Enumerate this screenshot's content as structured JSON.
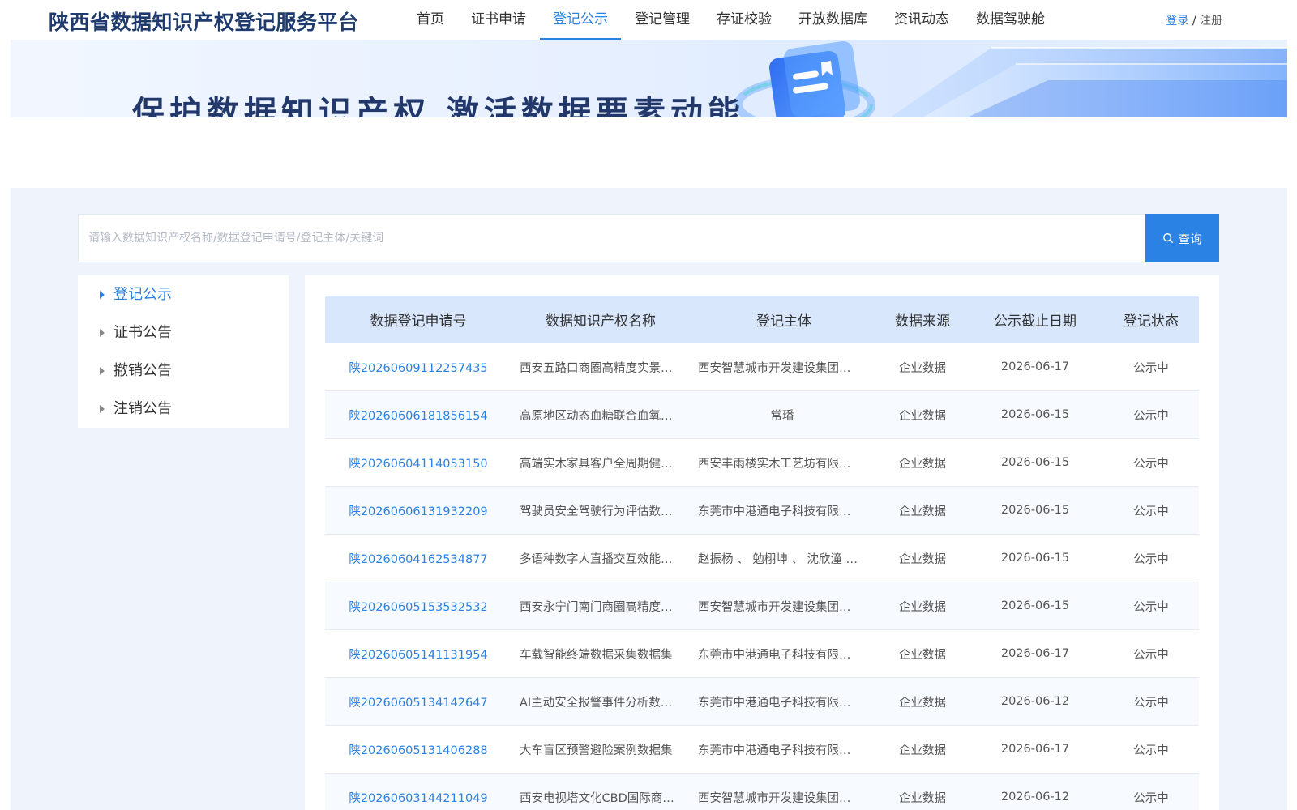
{
  "header": {
    "title": "陕西省数据知识产权登记服务平台",
    "nav": [
      "首页",
      "证书申请",
      "登记公示",
      "登记管理",
      "存证校验",
      "开放数据库",
      "资讯动态",
      "数据驾驶舱"
    ],
    "active_nav": 2,
    "login": "登录",
    "separator": " / ",
    "register": "注册"
  },
  "banner": {
    "slogan": "保护数据知识产权 激活数据要素动能"
  },
  "search": {
    "placeholder": "请输入数据知识产权名称/数据登记申请号/登记主体/关键词",
    "button_label": "查询"
  },
  "sidebar": {
    "items": [
      "登记公示",
      "证书公告",
      "撤销公告",
      "注销公告"
    ],
    "active": 0
  },
  "table": {
    "headers": [
      "数据登记申请号",
      "数据知识产权名称",
      "登记主体",
      "数据来源",
      "公示截止日期",
      "登记状态"
    ],
    "rows": [
      [
        "陕20260609112257435",
        "西安五路口商圈高精度实景…",
        "西安智慧城市开发建设集团…",
        "企业数据",
        "2026-06-17",
        "公示中"
      ],
      [
        "陕20260606181856154",
        "高原地区动态血糖联合血氧…",
        "常璠",
        "企业数据",
        "2026-06-15",
        "公示中"
      ],
      [
        "陕20260604114053150",
        "高端实木家具客户全周期健…",
        "西安丰雨楼实木工艺坊有限…",
        "企业数据",
        "2026-06-15",
        "公示中"
      ],
      [
        "陕20260606131932209",
        "驾驶员安全驾驶行为评估数…",
        "东莞市中港通电子科技有限…",
        "企业数据",
        "2026-06-15",
        "公示中"
      ],
      [
        "陕20260604162534877",
        "多语种数字人直播交互效能…",
        "赵振杨 、 勉栩坤 、 沈欣潼 …",
        "企业数据",
        "2026-06-15",
        "公示中"
      ],
      [
        "陕20260605153532532",
        "西安永宁门南门商圈高精度…",
        "西安智慧城市开发建设集团…",
        "企业数据",
        "2026-06-15",
        "公示中"
      ],
      [
        "陕20260605141131954",
        "车载智能终端数据采集数据集",
        "东莞市中港通电子科技有限…",
        "企业数据",
        "2026-06-17",
        "公示中"
      ],
      [
        "陕20260605134142647",
        "AI主动安全报警事件分析数…",
        "东莞市中港通电子科技有限…",
        "企业数据",
        "2026-06-12",
        "公示中"
      ],
      [
        "陕20260605131406288",
        "大车盲区预警避险案例数据集",
        "东莞市中港通电子科技有限…",
        "企业数据",
        "2026-06-17",
        "公示中"
      ],
      [
        "陕20260603144211049",
        "西安电视塔文化CBD国际商…",
        "西安智慧城市开发建设集团…",
        "企业数据",
        "2026-06-12",
        "公示中"
      ]
    ]
  },
  "colors": {
    "accent": "#2a82e4",
    "title": "#1f3b6e",
    "header_row": "#d9e7fd",
    "background": "#eef3fc"
  },
  "icons": {
    "search": "search-icon",
    "sidebar_caret": "caret-right-icon"
  }
}
